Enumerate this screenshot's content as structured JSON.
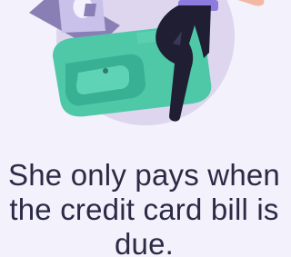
{
  "caption": "She only pays when the credit card bill is due.",
  "colors": {
    "background": "#f3f1fb",
    "circle": "#ddd6ee",
    "wallet": "#4fc8a8",
    "wallet_dark": "#38b093",
    "cash": "#8a7fb5",
    "card": "#c9c1ea",
    "pants": "#1f1e33",
    "shirt": "#8f7be0",
    "skin": "#f2b8a2",
    "text": "#2c2a45"
  },
  "illustration": {
    "items": [
      "wallet-icon",
      "cash-icon",
      "person-legs-icon"
    ]
  }
}
